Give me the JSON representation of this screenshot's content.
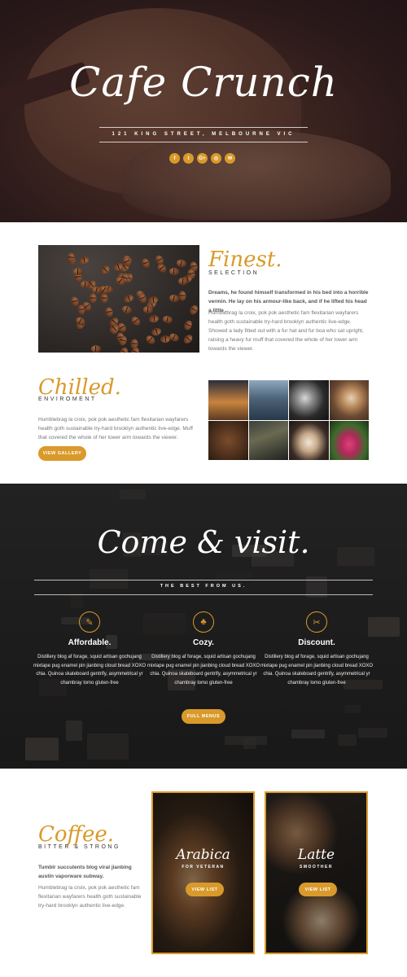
{
  "hero": {
    "title": "Cafe Crunch",
    "address": "121 KING STREET, MELBOURNE VIC",
    "social_icons": [
      "facebook-icon",
      "twitter-icon",
      "google-plus-icon",
      "instagram-icon",
      "email-icon"
    ],
    "social_glyphs": [
      "f",
      "t",
      "G+",
      "◎",
      "✉"
    ]
  },
  "finest": {
    "script_title": "Finest.",
    "subtitle": "SELECTION",
    "lead": "Dreams, he found himself transformed in his bed into a horrible vermin. He lay on his armour-like back, and if he lifted his head a little .",
    "body": "Humblebrag la croix, pok pok aesthetic fam flexitarian wayfarers health goth sustainable try-hard brooklyn authentic live-edge. Showed a lady fitted out with a fur hat and fur boa who sat upright, raising a heavy fur muff that covered the whole of her lower arm towards the viewer."
  },
  "chilled": {
    "script_title": "Chilled.",
    "subtitle": "ENVIROMENT",
    "body": "Humblebrag la croix, pok pok aesthetic fam flexitarian wayfarers health goth sustainable try-hard brooklyn authentic live-edge. Muff that covered the whole of her lower arm towards the viewer.",
    "button_label": "VIEW GALLERY"
  },
  "visit": {
    "script_title": "Come & visit.",
    "subtitle": "THE BEST FROM US.",
    "features": [
      {
        "icon": "ticket-icon",
        "glyph": "✎",
        "title": "Affordable.",
        "text": "Distillery blog af forage, squid artisan gochujang mixtape pug enamel pin jianbing cloud bread XOXO chia. Quinoa skateboard gentrify, asymmetrical yr chambray lomo gluten-free"
      },
      {
        "icon": "tree-icon",
        "glyph": "♣",
        "title": "Cozy.",
        "text": "Distillery blog af forage, squid artisan gochujang mixtape pug enamel pin jianbing cloud bread XOXO chia. Quinoa skateboard gentrify, asymmetrical yr chambray lomo gluten-free"
      },
      {
        "icon": "scissors-icon",
        "glyph": "✂",
        "title": "Discount.",
        "text": "Distillery blog af forage, squid artisan gochujang mixtape pug enamel pin jianbing cloud bread XOXO chia. Quinoa skateboard gentrify, asymmetrical yr chambray lomo gluten-free"
      }
    ],
    "button_label": "FULL MENUS"
  },
  "coffee": {
    "script_title": "Coffee.",
    "subtitle": "BITTER & STRONG",
    "lead": "Tumblr succulents blog viral jianbing austin vaporware subway.",
    "body": "Humblebrag la croix, pok pok aesthetic fam flexitarian wayfarers health goth sustainable try-hard brooklyn authentic live-edge.",
    "cards": [
      {
        "title": "Arabica",
        "subtitle": "FOR VETERAN",
        "button_label": "VIEW LIST"
      },
      {
        "title": "Latte",
        "subtitle": "SMOOTHER",
        "button_label": "VIEW LIST"
      }
    ]
  },
  "colors": {
    "accent": "#d99a2b",
    "dark": "#232222"
  }
}
